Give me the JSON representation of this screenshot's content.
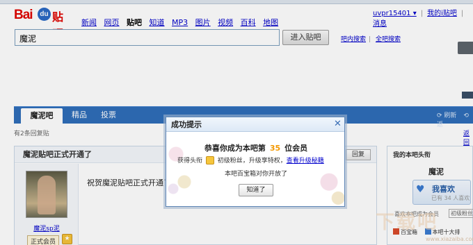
{
  "header": {
    "logo": {
      "bai": "Bai",
      "du": "du",
      "tieba": "贴吧"
    },
    "nav": [
      "新闻",
      "网页",
      "贴吧",
      "知道",
      "MP3",
      "图片",
      "视频",
      "百科",
      "地图"
    ],
    "nav_current_index": 2,
    "user": {
      "name": "uvpr15401 ▾",
      "my_tieba": "我的i贴吧",
      "messages": "消息"
    }
  },
  "search": {
    "value": "魔泥",
    "button": "进入贴吧",
    "in_bar_search": "吧内搜索",
    "global_search": "全吧搜索"
  },
  "tabs": {
    "items": [
      "魔泥吧",
      "精品",
      "投票"
    ],
    "active_index": 0,
    "refresh": "⟳ 刷新",
    "back": "⟲ 返"
  },
  "tips": {
    "text": "有2条回复贴",
    "return": "返回"
  },
  "thread": {
    "title": "魔泥贴吧正式开通了",
    "reply_button": "回复",
    "author": "魔泥sp泥",
    "member_badge": "正式会员",
    "body": "祝贺魔泥贴吧正式开通了"
  },
  "side": {
    "title": "我的本吧头衔",
    "bar_name": "魔泥",
    "like_label": "我喜欢",
    "like_count": "已有 34 人喜欢",
    "member_text": "喜欢本吧成为会员",
    "level_select": "初级粉丝",
    "treasure": "百宝箱",
    "bar_ten": "本吧十大排"
  },
  "dialog": {
    "title": "成功提示",
    "close": "✕",
    "headline_before": "恭喜你成为本吧第",
    "number": "35",
    "headline_after": "位会员",
    "line2_a": "获得头衔",
    "line2_b": "初级粉丝，升级享特权，",
    "upgrade_link": "查看升级秘籍",
    "line3": "本吧百宝箱对你开放了",
    "ok": "知道了"
  },
  "watermark": {
    "text": "下载吧",
    "url": "www.xiazaiba.com"
  },
  "colors": {
    "brand_blue": "#2f6eb9",
    "brand_red": "#e10602",
    "accent_orange": "#f39800",
    "link": "#0000cc"
  }
}
